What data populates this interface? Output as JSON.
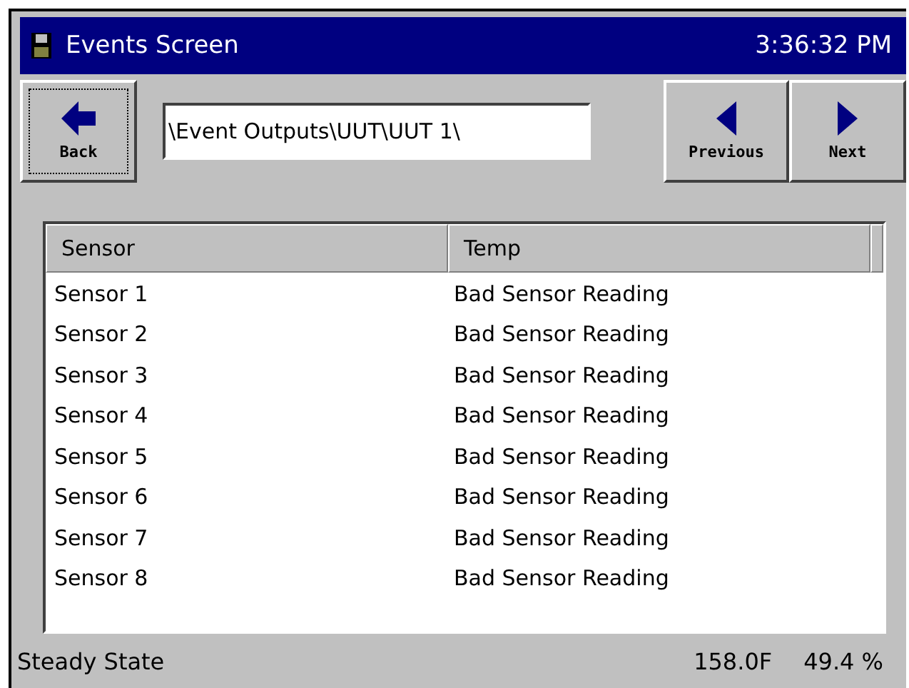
{
  "window": {
    "title": "Events Screen",
    "time": "3:36:32 PM"
  },
  "toolbar": {
    "back": "Back",
    "path": "\\Event Outputs\\UUT\\UUT 1\\",
    "previous": "Previous",
    "next": "Next"
  },
  "table": {
    "columns": [
      "Sensor",
      "Temp"
    ],
    "rows": [
      [
        "Sensor 1",
        "Bad Sensor Reading"
      ],
      [
        "Sensor 2",
        "Bad Sensor Reading"
      ],
      [
        "Sensor 3",
        "Bad Sensor Reading"
      ],
      [
        "Sensor 4",
        "Bad Sensor Reading"
      ],
      [
        "Sensor 5",
        "Bad Sensor Reading"
      ],
      [
        "Sensor 6",
        "Bad Sensor Reading"
      ],
      [
        "Sensor 7",
        "Bad Sensor Reading"
      ],
      [
        "Sensor 8",
        "Bad Sensor Reading"
      ]
    ]
  },
  "status_bar": {
    "state": "Steady State",
    "temperature": "158.0F",
    "humidity": "49.4 %"
  }
}
